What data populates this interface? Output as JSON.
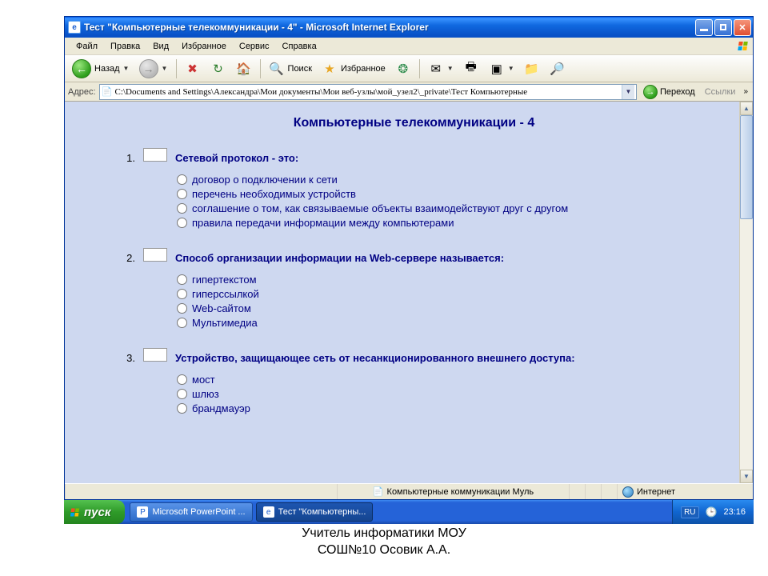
{
  "window": {
    "title": "Тест \"Компьютерные телекоммуникации - 4\" - Microsoft Internet Explorer"
  },
  "menu": {
    "items": [
      "Файл",
      "Правка",
      "Вид",
      "Избранное",
      "Сервис",
      "Справка"
    ]
  },
  "toolbar": {
    "back": "Назад",
    "search": "Поиск",
    "favorites": "Избранное"
  },
  "address": {
    "label": "Адрес:",
    "value": "C:\\Documents and Settings\\Александра\\Мои документы\\Мои веб-узлы\\мой_узел2\\_private\\Тест Компьютерные",
    "go": "Переход",
    "links": "Ссылки"
  },
  "page": {
    "title": "Компьютерные телекоммуникации - 4",
    "questions": [
      {
        "num": "1.",
        "text": "Сетевой протокол - это:",
        "options": [
          "договор о подключении к сети",
          "перечень необходимых устройств",
          "соглашение о том, как связываемые объекты взаимодействуют друг с другом",
          "правила передачи информации между компьютерами"
        ]
      },
      {
        "num": "2.",
        "text": "Способ организации информации на  Web-сервере называется:",
        "options": [
          "гипертекстом",
          "гиперссылкой",
          "Web-сайтом",
          "Мультимедиа"
        ]
      },
      {
        "num": "3.",
        "text": "Устройство, защищающее сеть от несанкционированного внешнего доступа:",
        "options": [
          "мост",
          "шлюз",
          "брандмауэр"
        ]
      }
    ]
  },
  "status": {
    "doc": "Компьютерные коммуникации Муль",
    "zone": "Интернет"
  },
  "taskbar": {
    "start": "пуск",
    "buttons": [
      {
        "label": "Microsoft PowerPoint ...",
        "active": false
      },
      {
        "label": "Тест \"Компьютерны...",
        "active": true
      }
    ],
    "lang": "RU",
    "time": "23:16"
  },
  "caption": {
    "line1": "Учитель информатики МОУ",
    "line2": "СОШ№10 Осовик А.А."
  }
}
